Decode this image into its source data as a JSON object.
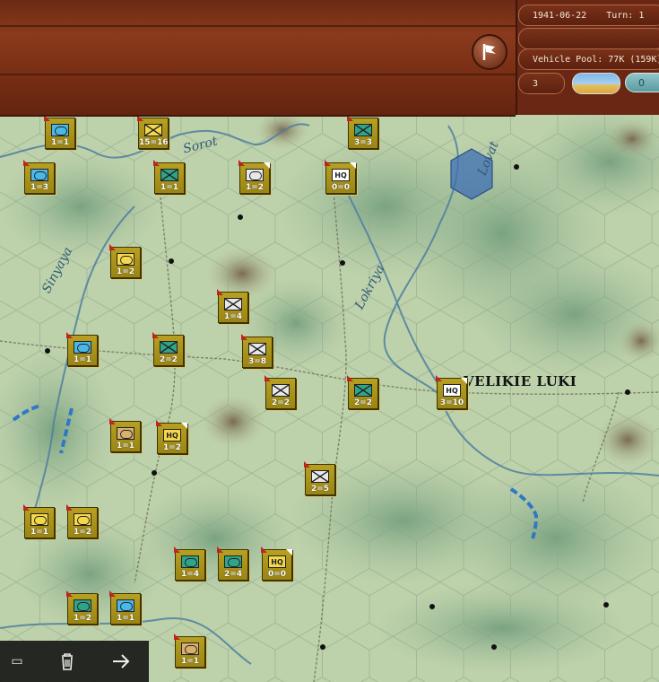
{
  "header": {
    "date": "1941-06-22",
    "turn_label": "Turn: 1",
    "vehicle_pool": "Vehicle Pool: 77K (159K)",
    "small_value": "3",
    "cyan_value": "0"
  },
  "map_labels": {
    "rivers": [
      "Sorot",
      "Sinyaya",
      "Lokriya",
      "Lovat"
    ],
    "city": "VELIKIE LUKI"
  },
  "units": [
    {
      "label": "1=1",
      "type": "blue-oval"
    },
    {
      "label": "15=16",
      "type": "inf-yellow"
    },
    {
      "label": "3=3",
      "type": "tank"
    },
    {
      "label": "1=3",
      "type": "blue-oval"
    },
    {
      "label": "1=1",
      "type": "tank"
    },
    {
      "label": "1=2",
      "type": "white-oval"
    },
    {
      "label": "0=0",
      "type": "hq"
    },
    {
      "label": "1=2",
      "type": "yellow-oval"
    },
    {
      "label": "1=4",
      "type": "inf"
    },
    {
      "label": "1=1",
      "type": "blue-rect"
    },
    {
      "label": "2=2",
      "type": "tank"
    },
    {
      "label": "3=8",
      "type": "inf"
    },
    {
      "label": "2=2",
      "type": "inf"
    },
    {
      "label": "2=2",
      "type": "tank"
    },
    {
      "label": "3=10",
      "type": "hq"
    },
    {
      "label": "1=1",
      "type": "tan-oval"
    },
    {
      "label": "1=2",
      "type": "hq-yellow"
    },
    {
      "label": "2=5",
      "type": "inf"
    },
    {
      "label": "1=1",
      "type": "yellow-oval"
    },
    {
      "label": "1=2",
      "type": "yellow-oval"
    },
    {
      "label": "1=4",
      "type": "tank-oval"
    },
    {
      "label": "2=4",
      "type": "tank-oval"
    },
    {
      "label": "0=0",
      "type": "hq-tan"
    },
    {
      "label": "1=2",
      "type": "tank-oval"
    },
    {
      "label": "1=1",
      "type": "blue-rect"
    },
    {
      "label": "1=1",
      "type": "tan-oval"
    }
  ],
  "colors": {
    "wood": "#7a3016",
    "counter": "#a88f18",
    "water": "#3f7fb3",
    "selected_hex": "#3d6fb4"
  },
  "toolbar": {
    "icons": [
      "screen-icon",
      "trash-icon",
      "arrow-right-icon"
    ]
  }
}
